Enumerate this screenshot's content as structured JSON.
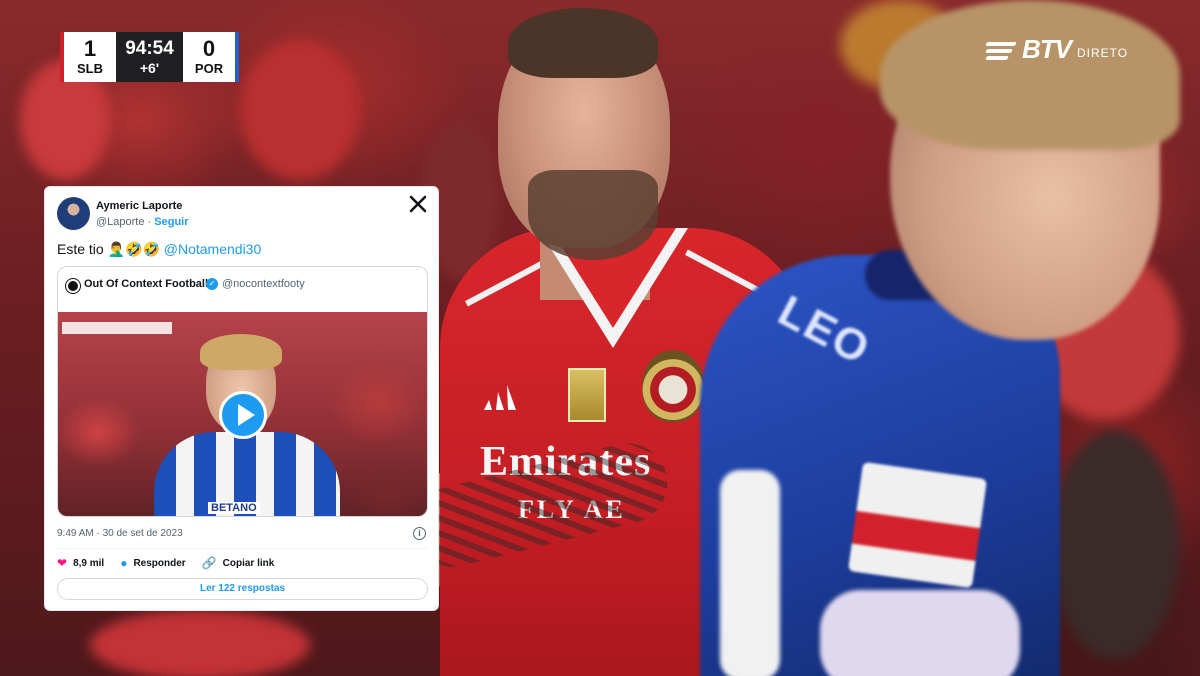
{
  "scorebug": {
    "home_score": "1",
    "home_team": "SLB",
    "clock": "94:54",
    "added_time": "+6'",
    "away_score": "0",
    "away_team": "POR",
    "home_color": "#d21f2a",
    "away_color": "#1f5fd2"
  },
  "channel": {
    "logo_text": "BTV",
    "live_label": "DIRETO"
  },
  "background": {
    "shirt_sponsor": "Emirates",
    "shirt_sponsor_line2": "FLY AE",
    "opponent_shirt_name": "LEO"
  },
  "tweet": {
    "author_name": "Aymeric Laporte",
    "author_handle": "@Laporte",
    "separator": " · ",
    "follow_label": "Seguir",
    "text_prefix": "Este tio 🤦‍♂️🤣🤣 ",
    "mention": "@Notamendi30",
    "quoted": {
      "author_name": "Out Of Context Football",
      "author_handle": "@nocontextfooty",
      "media_sponsor": "BETANO",
      "media_type": "video"
    },
    "timestamp": "9:49 AM · 30 de set de 2023",
    "info_icon": "i",
    "likes": "8,9 mil",
    "reply_label": "Responder",
    "copy_link_label": "Copiar link",
    "read_replies_label": "Ler 122 respostas",
    "accent_color": "#1d9bf0",
    "like_color": "#f91880"
  },
  "icons": {
    "close": "x-logo-icon",
    "like": "heart-icon",
    "reply": "speech-bubble-icon",
    "copy": "link-icon",
    "play": "play-icon",
    "verified": "verified-badge-icon"
  }
}
